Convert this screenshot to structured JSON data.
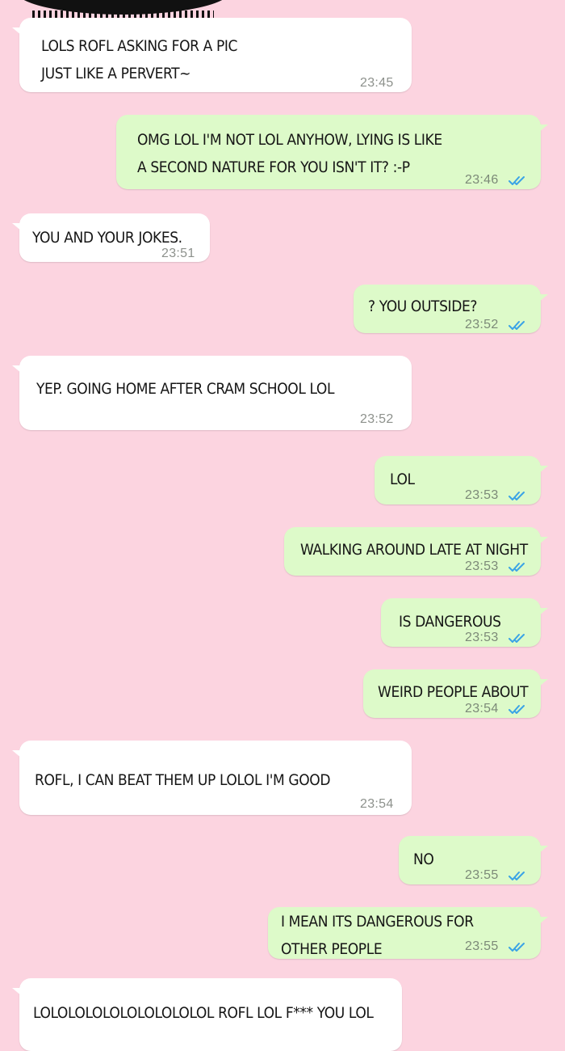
{
  "messages": [
    {
      "dir": "in",
      "text": "LOLS ROFL ASKING FOR A PIC\nJUST LIKE A PERVERT~",
      "time": "23:45"
    },
    {
      "dir": "out",
      "text": "OMG LOL I'M NOT LOL ANYHOW, LYING IS LIKE\nA SECOND NATURE FOR YOU ISN'T IT? :-P",
      "time": "23:46",
      "read": true
    },
    {
      "dir": "in",
      "text": "YOU AND YOUR JOKES.",
      "time": "23:51"
    },
    {
      "dir": "out",
      "text": "? YOU OUTSIDE?",
      "time": "23:52",
      "read": true
    },
    {
      "dir": "in",
      "text": "YEP. GOING HOME AFTER CRAM SCHOOL LOL",
      "time": "23:52"
    },
    {
      "dir": "out",
      "text": "LOL",
      "time": "23:53",
      "read": true
    },
    {
      "dir": "out",
      "text": "WALKING AROUND LATE AT NIGHT",
      "time": "23:53",
      "read": true
    },
    {
      "dir": "out",
      "text": "IS DANGEROUS",
      "time": "23:53",
      "read": true
    },
    {
      "dir": "out",
      "text": "WEIRD PEOPLE ABOUT",
      "time": "23:54",
      "read": true
    },
    {
      "dir": "in",
      "text": "ROFL, I CAN BEAT THEM UP LOLOL I'M GOOD",
      "time": "23:54"
    },
    {
      "dir": "out",
      "text": "NO",
      "time": "23:55",
      "read": true
    },
    {
      "dir": "out",
      "text": "I MEAN ITS DANGEROUS FOR\nOTHER PEOPLE",
      "time": "23:55",
      "read": true
    },
    {
      "dir": "in",
      "text": "LOLOLOLOLOLOLOLOLOLOL ROFL LOL F*** YOU LOL",
      "time": ""
    }
  ],
  "colors": {
    "background": "#fcd4e0",
    "incoming": "#ffffff",
    "outgoing": "#ddfac9",
    "read_ticks": "#3aa3e6"
  }
}
